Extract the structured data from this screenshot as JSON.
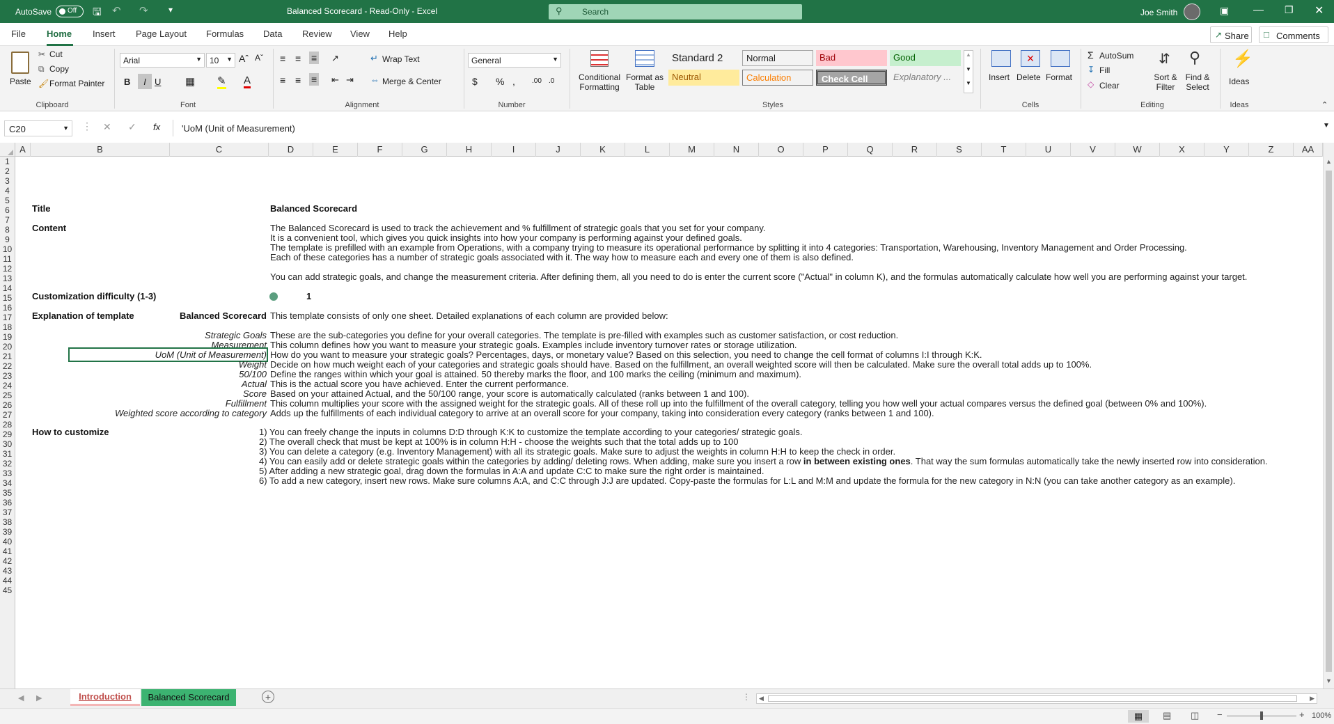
{
  "title_bar": {
    "autosave_label": "AutoSave",
    "autosave_state": "Off",
    "document_title": "Balanced Scorecard  -  Read-Only  -  Excel",
    "search_placeholder": "Search",
    "user_name": "Joe Smith"
  },
  "menu": {
    "tabs": [
      "File",
      "Home",
      "Insert",
      "Page Layout",
      "Formulas",
      "Data",
      "Review",
      "View",
      "Help"
    ],
    "active": "Home",
    "share_label": "Share",
    "comments_label": "Comments"
  },
  "ribbon": {
    "clipboard": {
      "paste": "Paste",
      "cut": "Cut",
      "copy": "Copy",
      "format_painter": "Format Painter",
      "group": "Clipboard"
    },
    "font": {
      "name": "Arial",
      "size": "10",
      "bold": "B",
      "italic": "I",
      "underline": "U",
      "group": "Font"
    },
    "alignment": {
      "wrap_text": "Wrap Text",
      "merge_center": "Merge & Center",
      "group": "Alignment"
    },
    "number": {
      "format": "General",
      "group": "Number"
    },
    "styles": {
      "conditional_formatting": "Conditional Formatting",
      "format_as_table": "Format as Table",
      "cells": [
        {
          "label": "Standard 2",
          "bg": "#ffffff",
          "color": "#000000"
        },
        {
          "label": "Normal",
          "bg": "#ffffff",
          "color": "#000000"
        },
        {
          "label": "Bad",
          "bg": "#ffc7ce",
          "color": "#9c0006"
        },
        {
          "label": "Good",
          "bg": "#c6efce",
          "color": "#006100"
        },
        {
          "label": "Neutral",
          "bg": "#ffeb9c",
          "color": "#9c5700"
        },
        {
          "label": "Calculation",
          "bg": "#f2f2f2",
          "color": "#fa7d00"
        },
        {
          "label": "Check Cell",
          "bg": "#a5a5a5",
          "color": "#ffffff"
        },
        {
          "label": "Explanatory ...",
          "bg": "#ffffff",
          "color": "#7f7f7f"
        }
      ],
      "group": "Styles"
    },
    "cells": {
      "insert": "Insert",
      "delete": "Delete",
      "format": "Format",
      "group": "Cells"
    },
    "editing": {
      "autosum": "AutoSum",
      "fill": "Fill",
      "clear": "Clear",
      "sort_filter": "Sort & Filter",
      "find_select": "Find & Select",
      "group": "Editing"
    },
    "ideas": {
      "label": "Ideas",
      "group": "Ideas"
    }
  },
  "formula_bar": {
    "name_box": "C20",
    "fx": "fx",
    "content": "'UoM (Unit of Measurement)"
  },
  "columns": [
    "A",
    "B",
    "C",
    "D",
    "E",
    "F",
    "G",
    "H",
    "I",
    "J",
    "K",
    "L",
    "M",
    "N",
    "O",
    "P",
    "Q",
    "R",
    "S",
    "T",
    "U",
    "V",
    "W",
    "X",
    "Y",
    "Z",
    "AA"
  ],
  "rows": [
    "1",
    "2",
    "3",
    "4",
    "5",
    "6",
    "7",
    "8",
    "9",
    "10",
    "11",
    "12",
    "13",
    "14",
    "15",
    "16",
    "17",
    "18",
    "19",
    "20",
    "21",
    "22",
    "23",
    "24",
    "25",
    "26",
    "27",
    "28",
    "29",
    "30",
    "31",
    "32",
    "33",
    "34",
    "35",
    "36",
    "37",
    "38",
    "39",
    "40",
    "41",
    "42",
    "43",
    "44",
    "45"
  ],
  "sheet": {
    "title_label": "Title",
    "title_value": "Balanced Scorecard",
    "content_label": "Content",
    "content_lines": [
      "The Balanced Scorecard is used to track the achievement and % fulfillment of strategic goals that you set for your company.",
      "It is a convenient tool, which gives you quick insights into how your company is performing against your defined goals.",
      "The template is prefilled with an example from Operations, with a company trying to measure its operational performance by splitting it into 4 categories: Transportation, Warehousing, Inventory Management and Order Processing.",
      "Each of these categories has a number of strategic goals associated with it. The way how to measure each and every one of them is also defined.",
      "You can add strategic goals, and change the measurement criteria. After defining them, all you need to do is enter the current score (\"Actual\" in column K), and the formulas automatically calculate how well you are performing against your target."
    ],
    "difficulty_label": "Customization difficulty (1-3)",
    "difficulty_value": "1",
    "difficulty_color": "#5b9e7f",
    "explanation_label": "Explanation of template",
    "explanation_sheet": "Balanced Scorecard",
    "explanation_text": "This template consists of only one sheet. Detailed explanations of each column are provided below:",
    "definitions": [
      {
        "term": "Strategic Goals",
        "text": "These are the sub-categories you define for your overall categories. The template is pre-filled with examples such as customer satisfaction, or cost reduction."
      },
      {
        "term": "Measurement",
        "text": "This column defines how you want to measure your strategic goals. Examples include inventory turnover rates or storage utilization."
      },
      {
        "term": "UoM (Unit of Measurement)",
        "text": "How do you want to measure your strategic goals? Percentages, days, or monetary value? Based on this selection, you need to change the cell format of columns I:I through K:K."
      },
      {
        "term": "Weight",
        "text": "Decide on how much weight each of your categories and strategic goals should have. Based on the fulfillment, an overall weighted score will then be calculated. Make sure the overall total adds up to 100%."
      },
      {
        "term": "50/100",
        "text": "Define the ranges within which your goal is attained. 50 thereby marks the floor, and 100 marks the ceiling (minimum and maximum)."
      },
      {
        "term": "Actual",
        "text": "This is the actual score you have achieved. Enter the current performance."
      },
      {
        "term": "Score",
        "text": "Based on your attained Actual, and the 50/100 range, your score is automatically calculated (ranks between 1 and 100)."
      },
      {
        "term": "Fulfillment",
        "text": "This column multiplies your score with the assigned weight for the strategic goals. All of these roll up into the fulfillment of the overall category, telling you how well your actual compares versus the defined goal (between 0% and 100%)."
      },
      {
        "term": "Weighted score according to category",
        "text": "Adds up the fulfillments of each individual category to arrive at an overall score for your company, taking into consideration every category (ranks between 1 and 100)."
      }
    ],
    "customize_label": "How to customize",
    "customize_steps": [
      "1) You can freely change the inputs in columns D:D through K:K to customize the template according to your categories/ strategic goals.",
      "2) The overall check that must be kept at 100% is in column H:H - choose the weights such that the total adds up to 100",
      "3) You can delete a category (e.g. Inventory Management) with all its strategic goals. Make sure to adjust the weights in column H:H to keep the check in order.",
      "4) You can easily add or delete strategic goals within the categories by adding/ deleting rows. When adding, make sure you insert a row ",
      "5) After adding a new strategic goal, drag down the formulas in A:A and update C:C to make sure the right order is maintained.",
      "6) To add a new category, insert new rows. Make sure columns A:A, and C:C through J:J are updated. Copy-paste the formulas for L:L and M:M and update the formula for the new category in N:N (you can take another category as an example)."
    ],
    "step4_bold": "in between existing ones",
    "step4_tail": ". That way the sum formulas automatically take the newly inserted row into consideration."
  },
  "tabs": {
    "sheets": [
      "Introduction",
      "Balanced Scorecard"
    ],
    "active": "Introduction",
    "intro_color": "#f4b6b6",
    "scorecard_color": "#3cb371"
  },
  "status": {
    "zoom": "100%"
  }
}
